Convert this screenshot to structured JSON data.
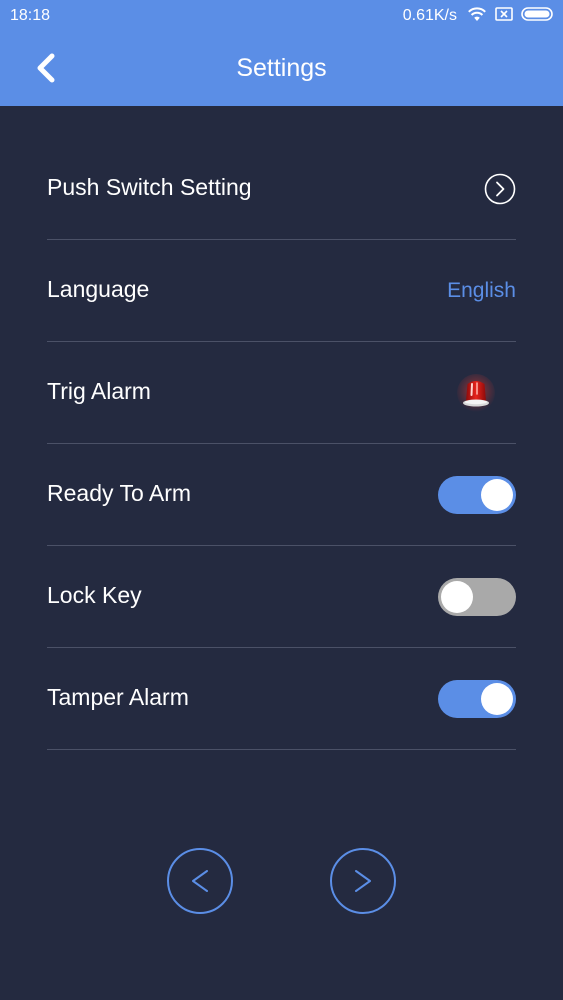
{
  "status_bar": {
    "time": "18:18",
    "network_speed": "0.61K/s",
    "icons": [
      "wifi-icon",
      "no-sim-icon",
      "battery-icon"
    ]
  },
  "header": {
    "title": "Settings",
    "back_icon": "chevron-left-icon"
  },
  "settings": {
    "push_switch": {
      "label": "Push Switch Setting",
      "icon": "chevron-right-circle-icon"
    },
    "language": {
      "label": "Language",
      "value": "English"
    },
    "trig_alarm": {
      "label": "Trig Alarm",
      "icon": "red-siren-icon"
    },
    "ready_to_arm": {
      "label": "Ready To Arm",
      "state": "on"
    },
    "lock_key": {
      "label": "Lock Key",
      "state": "off"
    },
    "tamper_alarm": {
      "label": "Tamper Alarm",
      "state": "on"
    }
  },
  "navigation": {
    "prev_icon": "chevron-left-icon",
    "next_icon": "chevron-right-icon"
  },
  "colors": {
    "accent": "#5b8ee6",
    "background": "#242a40",
    "divider": "#4b5167",
    "toggle_off": "#a9a9a9"
  }
}
